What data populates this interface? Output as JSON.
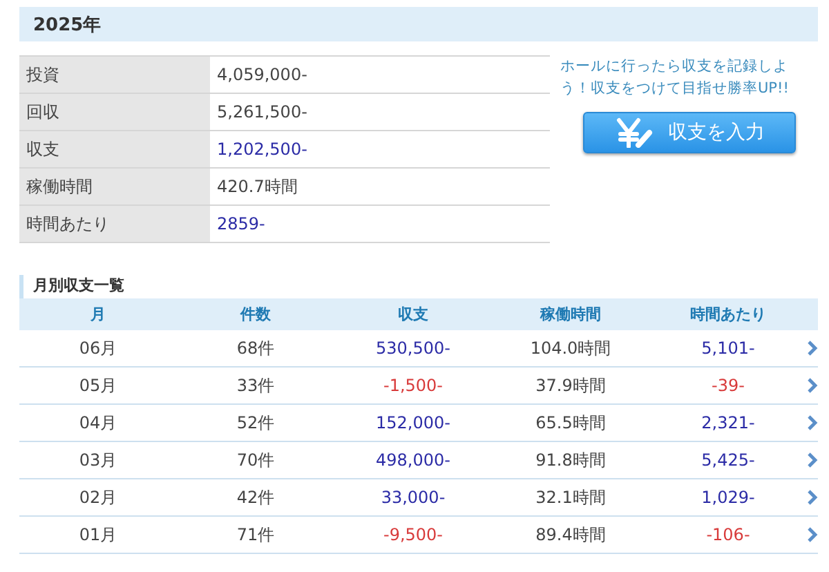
{
  "year_header": "2025年",
  "summary": [
    {
      "label": "投資",
      "value": "4,059,000-",
      "kind": "plain"
    },
    {
      "label": "回収",
      "value": "5,261,500-",
      "kind": "plain"
    },
    {
      "label": "収支",
      "value": "1,202,500-",
      "kind": "plus"
    },
    {
      "label": "稼働時間",
      "value": "420.7時間",
      "kind": "plain"
    },
    {
      "label": "時間あたり",
      "value": "2859-",
      "kind": "plus"
    }
  ],
  "promo": {
    "text": "ホールに行ったら収支を記録しよう！収支をつけて目指せ勝率UP!!",
    "button": "収支を入力"
  },
  "monthly": {
    "title": "月別収支一覧",
    "columns": [
      "月",
      "件数",
      "収支",
      "稼働時間",
      "時間あたり"
    ],
    "rows": [
      {
        "month": "06月",
        "count": "68件",
        "profit": "530,500-",
        "hours": "104.0時間",
        "per_hour": "5,101-",
        "kind": "plus"
      },
      {
        "month": "05月",
        "count": "33件",
        "profit": "-1,500-",
        "hours": "37.9時間",
        "per_hour": "-39-",
        "kind": "minus"
      },
      {
        "month": "04月",
        "count": "52件",
        "profit": "152,000-",
        "hours": "65.5時間",
        "per_hour": "2,321-",
        "kind": "plus"
      },
      {
        "month": "03月",
        "count": "70件",
        "profit": "498,000-",
        "hours": "91.8時間",
        "per_hour": "5,425-",
        "kind": "plus"
      },
      {
        "month": "02月",
        "count": "42件",
        "profit": "33,000-",
        "hours": "32.1時間",
        "per_hour": "1,029-",
        "kind": "plus"
      },
      {
        "month": "01月",
        "count": "71件",
        "profit": "-9,500-",
        "hours": "89.4時間",
        "per_hour": "-106-",
        "kind": "minus"
      }
    ]
  }
}
